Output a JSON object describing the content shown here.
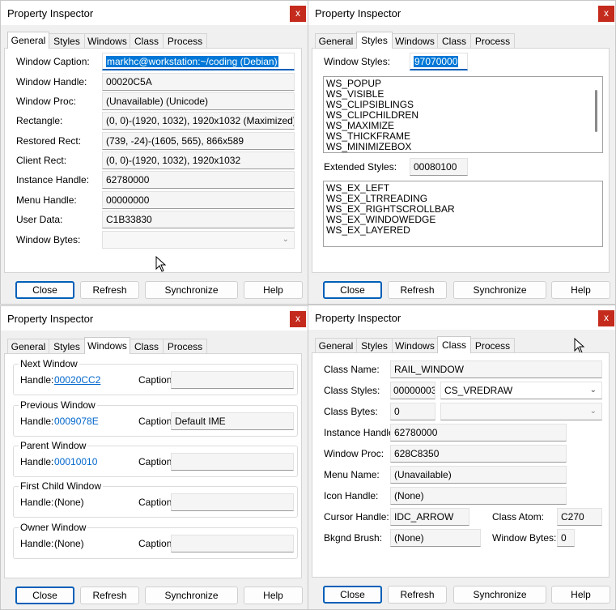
{
  "app_title": "Property Inspector",
  "close_glyph": "x",
  "tabs": [
    "General",
    "Styles",
    "Windows",
    "Class",
    "Process"
  ],
  "buttons": {
    "close": "Close",
    "refresh": "Refresh",
    "synchronize": "Synchronize",
    "help": "Help"
  },
  "general": {
    "window_caption_label": "Window Caption:",
    "window_caption": "markhc@workstation:~/coding (Debian)",
    "window_handle_label": "Window Handle:",
    "window_handle": "00020C5A",
    "window_proc_label": "Window Proc:",
    "window_proc": "(Unavailable) (Unicode)",
    "rectangle_label": "Rectangle:",
    "rectangle": "(0, 0)-(1920, 1032), 1920x1032 (Maximized)",
    "restored_rect_label": "Restored Rect:",
    "restored_rect": "(739, -24)-(1605, 565), 866x589",
    "client_rect_label": "Client Rect:",
    "client_rect": "(0, 0)-(1920, 1032), 1920x1032",
    "instance_handle_label": "Instance Handle:",
    "instance_handle": "62780000",
    "menu_handle_label": "Menu Handle:",
    "menu_handle": "00000000",
    "user_data_label": "User Data:",
    "user_data": "C1B33830",
    "window_bytes_label": "Window Bytes:",
    "window_bytes": ""
  },
  "styles": {
    "window_styles_label": "Window Styles:",
    "window_styles_value": "97070000",
    "window_styles_list": [
      "WS_POPUP",
      "WS_VISIBLE",
      "WS_CLIPSIBLINGS",
      "WS_CLIPCHILDREN",
      "WS_MAXIMIZE",
      "WS_THICKFRAME",
      "WS_MINIMIZEBOX"
    ],
    "extended_styles_label": "Extended Styles:",
    "extended_styles_value": "00080100",
    "extended_styles_list": [
      "WS_EX_LEFT",
      "WS_EX_LTRREADING",
      "WS_EX_RIGHTSCROLLBAR",
      "WS_EX_WINDOWEDGE",
      "WS_EX_LAYERED"
    ]
  },
  "windows": {
    "handle_label": "Handle:",
    "caption_label": "Caption:",
    "groups": [
      {
        "title": "Next Window",
        "handle": "00020CC2",
        "caption": ""
      },
      {
        "title": "Previous Window",
        "handle": "0009078E",
        "caption": "Default IME"
      },
      {
        "title": "Parent Window",
        "handle": "00010010",
        "caption": ""
      },
      {
        "title": "First Child Window",
        "handle": "(None)",
        "caption": ""
      },
      {
        "title": "Owner Window",
        "handle": "(None)",
        "caption": ""
      }
    ]
  },
  "class": {
    "class_name_label": "Class Name:",
    "class_name": "RAIL_WINDOW",
    "class_styles_label": "Class Styles:",
    "class_styles_value": "00000003",
    "class_styles_combo": "CS_VREDRAW",
    "class_bytes_label": "Class Bytes:",
    "class_bytes": "0",
    "class_bytes_combo": "",
    "instance_handle_label": "Instance Handle:",
    "instance_handle": "62780000",
    "window_proc_label": "Window Proc:",
    "window_proc": "628C8350",
    "menu_name_label": "Menu Name:",
    "menu_name": "(Unavailable)",
    "icon_handle_label": "Icon Handle:",
    "icon_handle": "(None)",
    "cursor_handle_label": "Cursor Handle:",
    "cursor_handle": "IDC_ARROW",
    "class_atom_label": "Class Atom:",
    "class_atom": "C270",
    "bkgnd_brush_label": "Bkgnd Brush:",
    "bkgnd_brush": "(None)",
    "window_bytes_label": "Window Bytes:",
    "window_bytes": "0"
  },
  "colors": {
    "accent": "#005fb8",
    "close": "#c42b1c",
    "link": "#0066cc",
    "selection": "#0078d7"
  }
}
